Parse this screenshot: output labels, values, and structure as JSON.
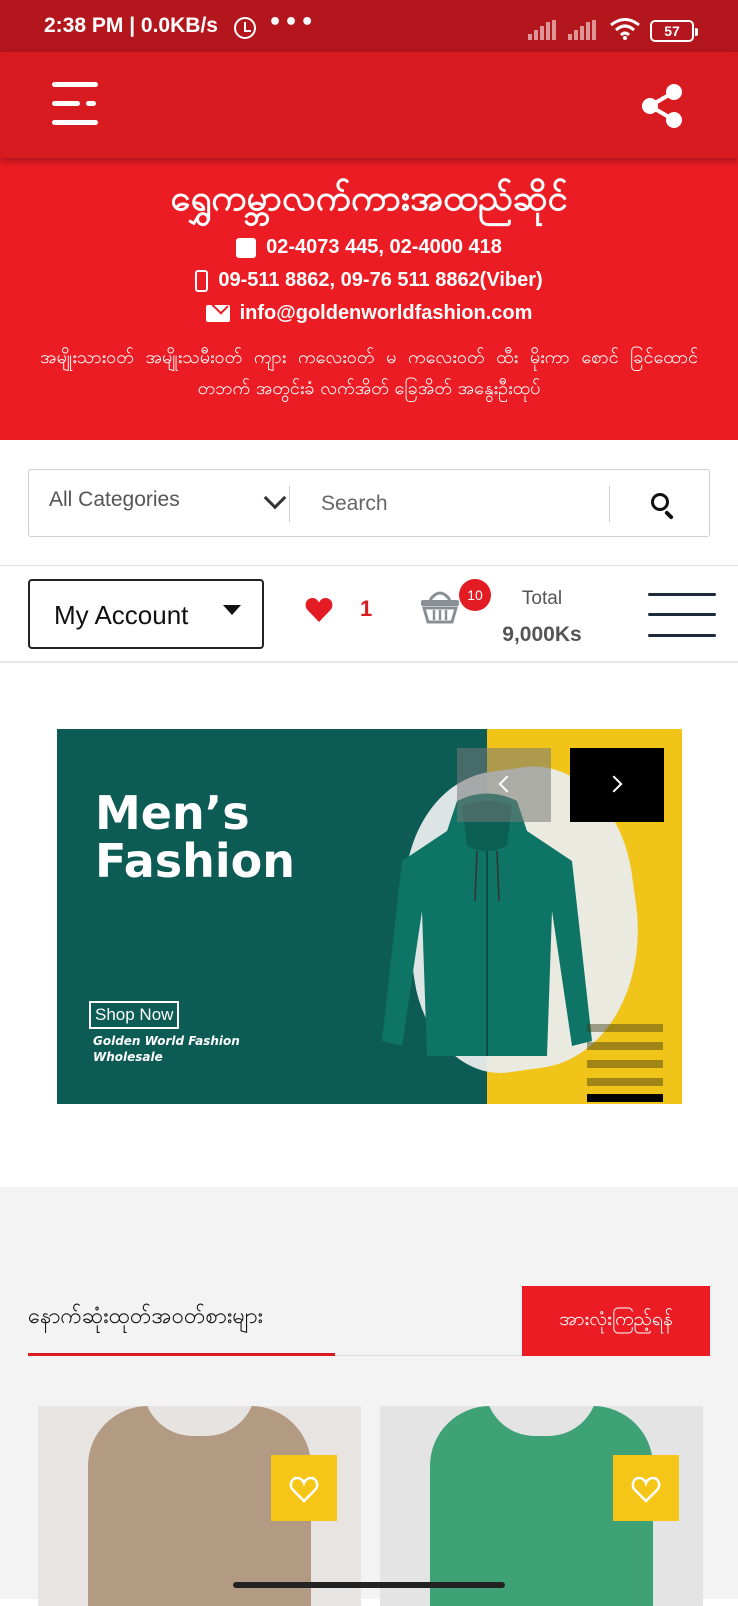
{
  "status_bar": {
    "time": "2:38 PM",
    "network_speed": "0.0KB/s",
    "more_indicator": "•••",
    "battery": "57",
    "icons": [
      "alarm-icon",
      "signal-icon",
      "signal-icon",
      "wifi-icon",
      "battery-icon"
    ]
  },
  "app_bar": {
    "menu_icon": "menu-icon",
    "share_icon": "share-icon",
    "color": "#d81b20"
  },
  "header": {
    "shop_name": "ရွှေကမ္ဘာလက်ကားအထည်ဆိုင်",
    "phones": "02-4073 445, 02-4000 418",
    "mobiles": "09-511 8862, 09-76 511 8862(Viber)",
    "email": "info@goldenworldfashion.com",
    "categories": "အမျိုးသားဝတ် အမျိုးသမီးဝတ် ကျား ကလေးဝတ် မ ကလေးဝတ် ထီး မိုးကာ စောင် ခြင်ထောင် တဘက် အတွင်းခံ လက်အိတ် ခြေအိတ် အနွေးဦးထုပ်",
    "color": "#ec1c24"
  },
  "search": {
    "category_value": "All Categories",
    "placeholder": "Search"
  },
  "account_row": {
    "account_label": "My Account",
    "wishlist_count": "1",
    "cart_count": "10",
    "total_label": "Total",
    "total_value": "9,000Ks"
  },
  "banner": {
    "title_line1": "Men’s",
    "title_line2": "Fashion",
    "shop_now": "Shop Now",
    "subtitle_line1": "Golden World Fashion",
    "subtitle_line2": "Wholesale"
  },
  "section": {
    "title": "နောက်ဆုံးထုတ်အဝတ်စားများ",
    "view_all": "အားလုံးကြည့်ရန်"
  },
  "products": [
    {
      "color": "#b39a82",
      "fav_icon": "heart-outline-icon"
    },
    {
      "color": "#3fa277",
      "fav_icon": "heart-outline-icon"
    }
  ]
}
